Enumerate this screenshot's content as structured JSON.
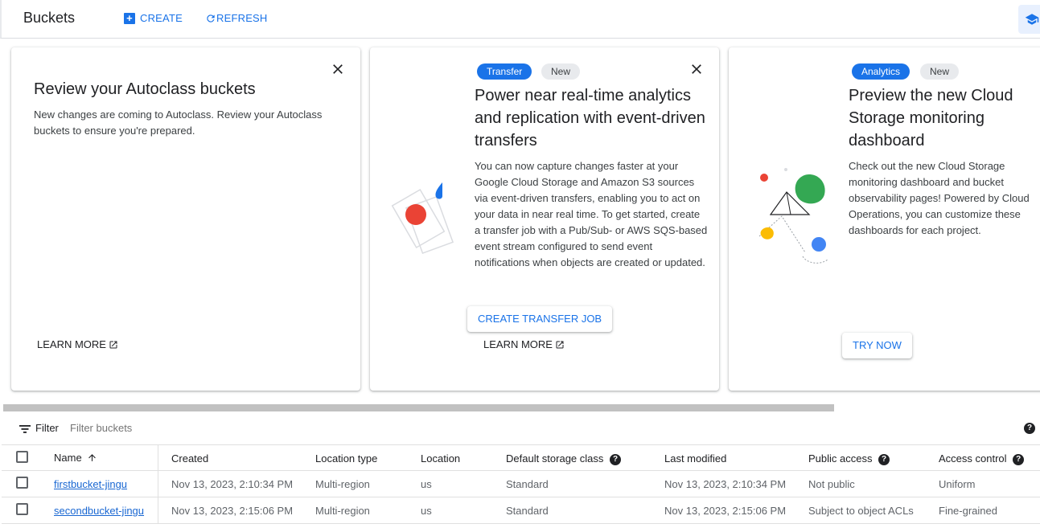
{
  "header": {
    "title": "Buckets",
    "create_label": "CREATE",
    "refresh_label": "REFRESH"
  },
  "cards": [
    {
      "title": "Review your Autoclass buckets",
      "body": "New changes are coming to Autoclass. Review your Autoclass buckets to ensure you're prepared.",
      "learn_more": "LEARN MORE"
    },
    {
      "chips": [
        "Transfer",
        "New"
      ],
      "title": "Power near real-time analytics and replication with event-driven transfers",
      "body": "You can now capture changes faster at your Google Cloud Storage and Amazon S3 sources via event-driven transfers, enabling you to act on your data in near real time. To get started, create a transfer job with a Pub/Sub- or AWS SQS-based event stream configured to send event notifications when objects are created or updated.",
      "button": "CREATE TRANSFER JOB",
      "learn_more": "LEARN MORE"
    },
    {
      "chips": [
        "Analytics",
        "New"
      ],
      "title": "Preview the new Cloud Storage monitoring dashboard",
      "body": "Check out the new Cloud Storage monitoring dashboard and bucket observability pages! Powered by Cloud Operations, you can customize these dashboards for each project.",
      "button": "TRY NOW"
    }
  ],
  "filter": {
    "label": "Filter",
    "placeholder": "Filter buckets"
  },
  "table": {
    "columns": [
      "Name",
      "Created",
      "Location type",
      "Location",
      "Default storage class",
      "Last modified",
      "Public access",
      "Access control"
    ],
    "rows": [
      [
        "firstbucket-jingu",
        "Nov 13, 2023, 2:10:34 PM",
        "Multi-region",
        "us",
        "Standard",
        "Nov 13, 2023, 2:10:34 PM",
        "Not public",
        "Uniform"
      ],
      [
        "secondbucket-jingu",
        "Nov 13, 2023, 2:15:06 PM",
        "Multi-region",
        "us",
        "Standard",
        "Nov 13, 2023, 2:15:06 PM",
        "Subject to object ACLs",
        "Fine-grained"
      ]
    ]
  },
  "colors": {
    "accent": "#1a73e8",
    "red": "#ea4335",
    "green": "#34a853",
    "yellow": "#fbbc04"
  },
  "icons": [
    "plus-box-icon",
    "refresh-icon",
    "school-hat-icon",
    "close-icon",
    "open-in-new-icon",
    "filter-list-icon",
    "help-icon",
    "sort-arrow-up-icon"
  ]
}
